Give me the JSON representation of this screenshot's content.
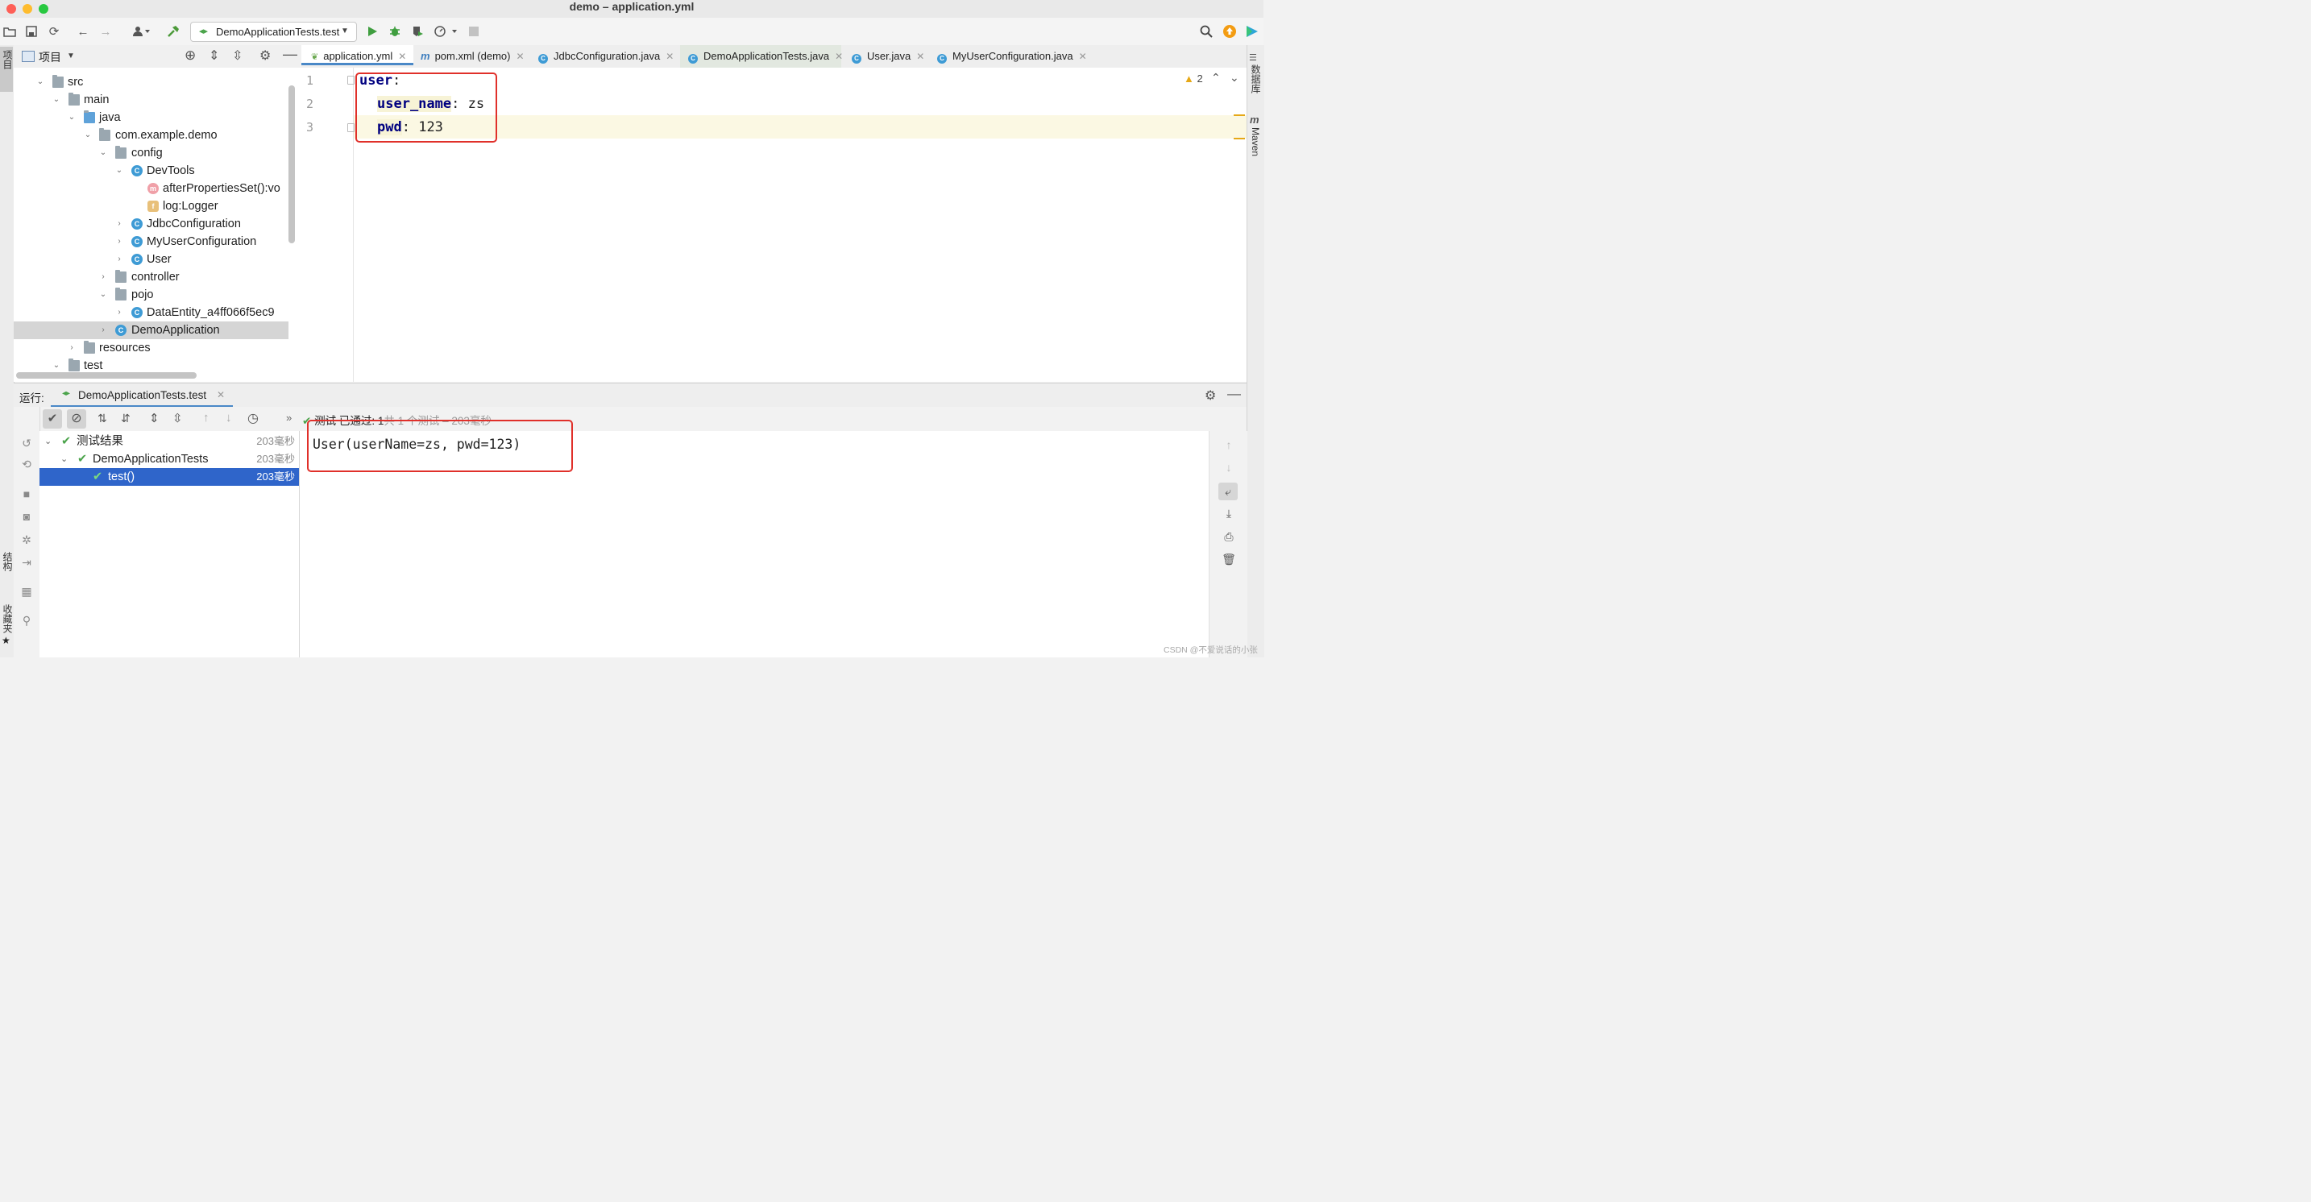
{
  "window": {
    "title": "demo – application.yml"
  },
  "toolbar": {
    "run_config": "DemoApplicationTests.test",
    "icons": [
      "open-folder-icon",
      "save-icon",
      "sync-icon",
      "back-arrow-icon",
      "forward-arrow-icon",
      "user-icon",
      "hammer-icon",
      "run-icon",
      "debug-icon",
      "coverage-icon",
      "profile-icon",
      "stop-icon",
      "search-icon",
      "update-icon",
      "toolbox-icon"
    ]
  },
  "left_stripe": {
    "project_label": "项目",
    "structure_label": "结构",
    "favorites_label": "收藏夹"
  },
  "right_stripe": {
    "database_label": "数据库",
    "maven_label": "Maven"
  },
  "project_panel": {
    "title": "项目",
    "tree": [
      {
        "label": "src",
        "icon": "folder"
      },
      {
        "label": "main",
        "icon": "folder"
      },
      {
        "label": "java",
        "icon": "source-folder"
      },
      {
        "label": "com.example.demo",
        "icon": "package"
      },
      {
        "label": "config",
        "icon": "package"
      },
      {
        "label": "DevTools",
        "icon": "class"
      },
      {
        "label": "afterPropertiesSet():vo",
        "icon": "method"
      },
      {
        "label": "log:Logger",
        "icon": "field"
      },
      {
        "label": "JdbcConfiguration",
        "icon": "class"
      },
      {
        "label": "MyUserConfiguration",
        "icon": "class"
      },
      {
        "label": "User",
        "icon": "class"
      },
      {
        "label": "controller",
        "icon": "package"
      },
      {
        "label": "pojo",
        "icon": "package"
      },
      {
        "label": "DataEntity_a4ff066f5ec9",
        "icon": "class"
      },
      {
        "label": "DemoApplication",
        "icon": "spring-class"
      },
      {
        "label": "resources",
        "icon": "resources-folder"
      },
      {
        "label": "test",
        "icon": "folder"
      }
    ]
  },
  "editor": {
    "tabs": [
      {
        "label": "application.yml",
        "active": true
      },
      {
        "label": "pom.xml (demo)"
      },
      {
        "label": "JdbcConfiguration.java"
      },
      {
        "label": "DemoApplicationTests.java"
      },
      {
        "label": "User.java"
      },
      {
        "label": "MyUserConfiguration.java"
      }
    ],
    "line_numbers": [
      "1",
      "2",
      "3"
    ],
    "lines": [
      {
        "key": "user",
        "sep": ":",
        "value": ""
      },
      {
        "key": "user_name",
        "sep": ": ",
        "value": "zs"
      },
      {
        "key": "pwd",
        "sep": ": ",
        "value": "123"
      }
    ],
    "warning_count": "2"
  },
  "run_panel": {
    "label": "运行:",
    "tab": "DemoApplicationTests.test",
    "status_passed": "测试 已通过: 1",
    "status_detail": "共 1 个测试 – 203毫秒",
    "tree": [
      {
        "label": "测试结果",
        "time": "203毫秒"
      },
      {
        "label": "DemoApplicationTests",
        "time": "203毫秒"
      },
      {
        "label": "test()",
        "time": "203毫秒"
      }
    ],
    "console_output": "User(userName=zs, pwd=123)"
  },
  "watermark": "CSDN @不爱说话的小张",
  "colors": {
    "accent_red": "#e0302a",
    "selection": "#2f65ca",
    "yaml_key": "#000080",
    "pass_green": "#4aa34a"
  }
}
